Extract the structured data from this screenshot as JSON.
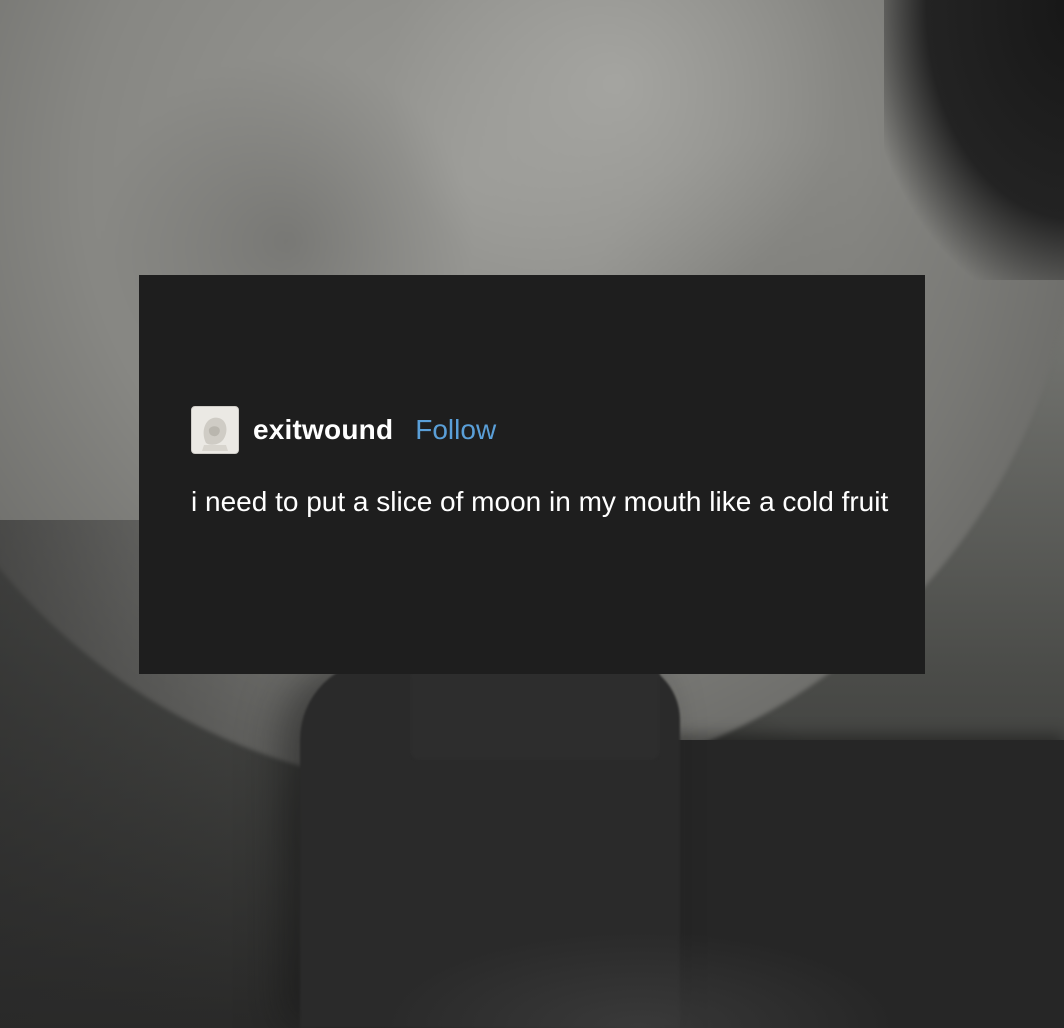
{
  "post": {
    "username": "exitwound",
    "follow_label": "Follow",
    "body_text": "i need to put a slice of moon in my mouth like a cold fruit",
    "avatar_icon": "statue-avatar-icon"
  },
  "colors": {
    "card_background": "#1e1e1e",
    "text": "#ffffff",
    "follow_link": "#5a9fd8"
  }
}
